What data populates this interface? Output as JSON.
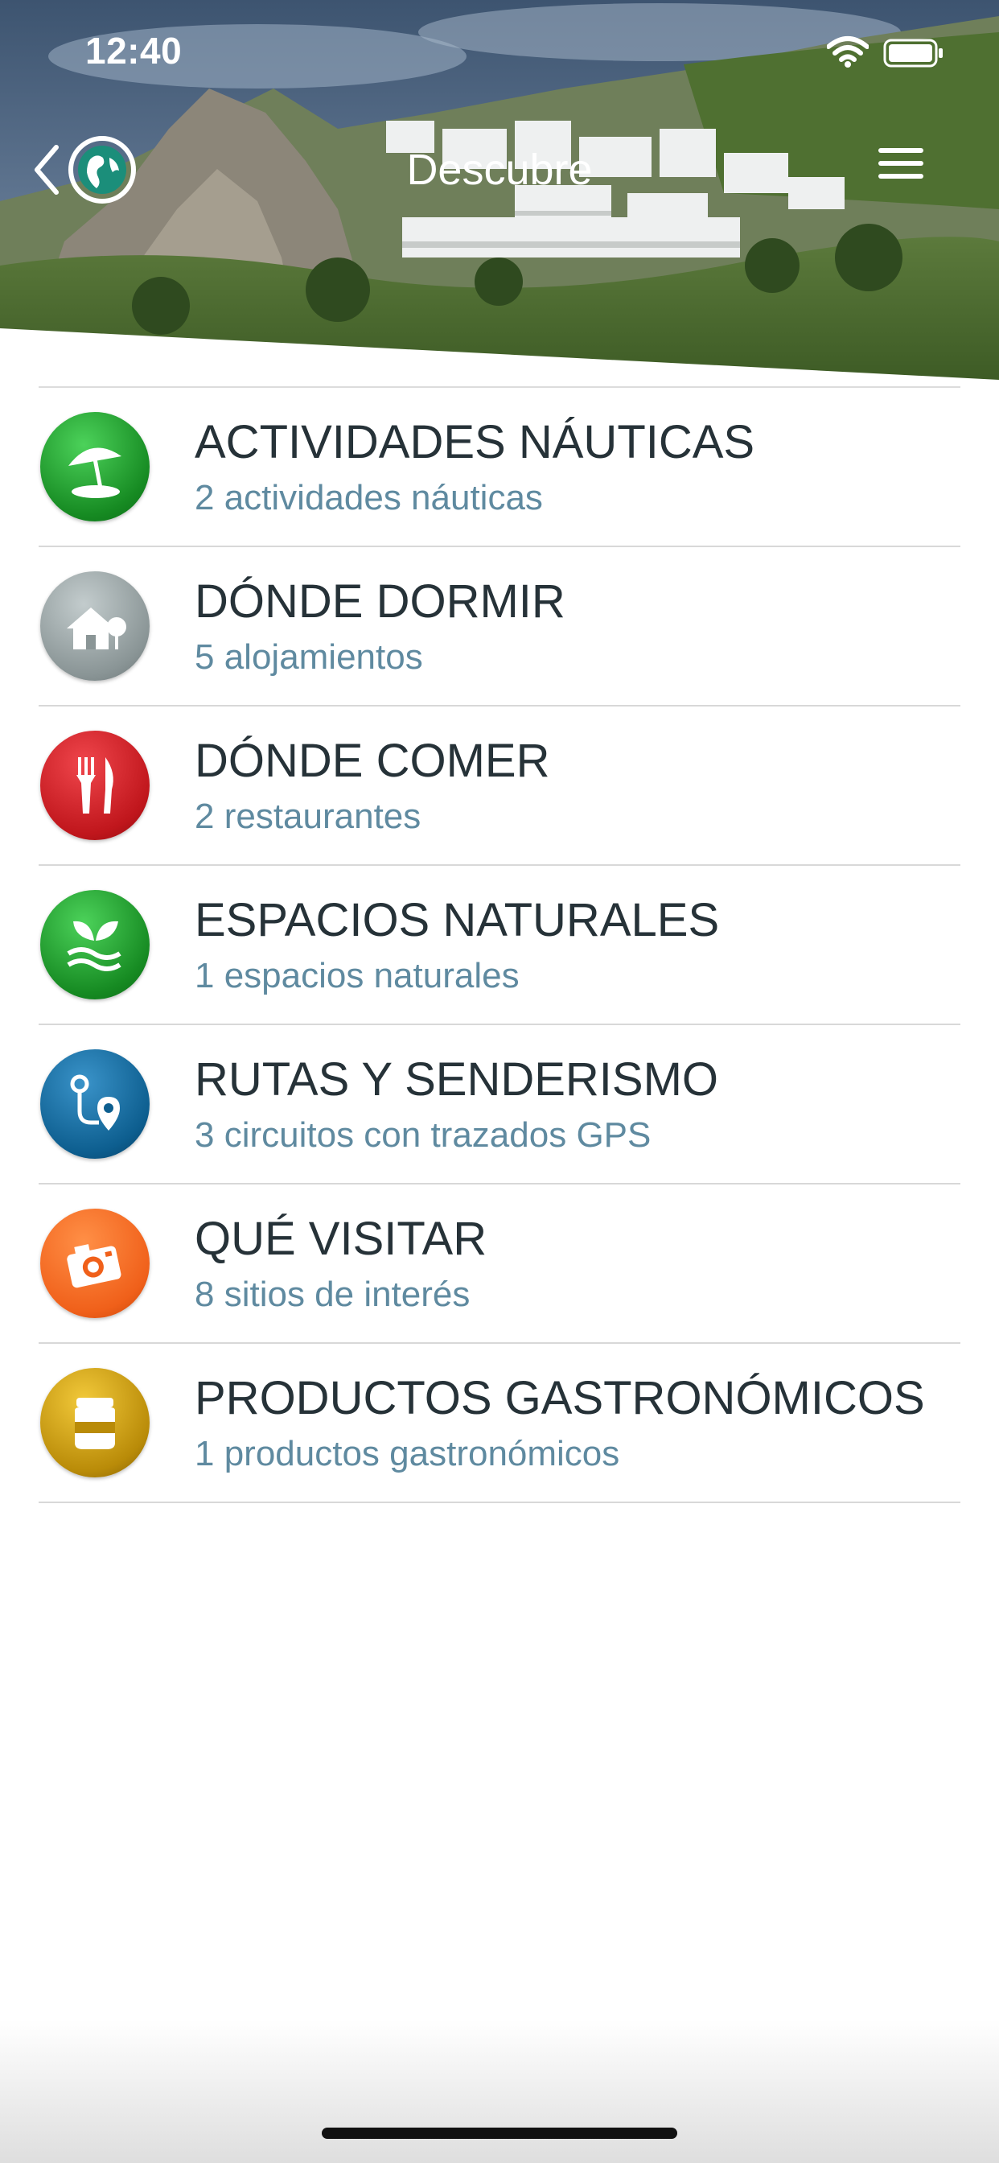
{
  "status_bar": {
    "time": "12:40"
  },
  "header": {
    "title": "Descubre"
  },
  "icons": {
    "back": "chevron-left-icon",
    "globe": "globe-icon",
    "menu": "hamburger-menu-icon",
    "wifi": "wifi-icon",
    "battery": "battery-icon"
  },
  "categories": [
    {
      "title": "ACTIVIDADES NÁUTICAS",
      "subtitle": "2 actividades náuticas",
      "icon": "beach-umbrella-icon",
      "color": "#1f9e2a"
    },
    {
      "title": "DÓNDE DORMIR",
      "subtitle": "5 alojamientos",
      "icon": "house-icon",
      "color": "#8a9596"
    },
    {
      "title": "DÓNDE COMER",
      "subtitle": "2 restaurantes",
      "icon": "fork-knife-icon",
      "color": "#c0161c"
    },
    {
      "title": "ESPACIOS NATURALES",
      "subtitle": "1 espacios naturales",
      "icon": "leaf-icon",
      "color": "#1f9e2a"
    },
    {
      "title": "RUTAS Y SENDERISMO",
      "subtitle": "3 circuitos con trazados GPS",
      "icon": "route-pin-icon",
      "color": "#0d5e8f"
    },
    {
      "title": "QUÉ VISITAR",
      "subtitle": "8 sitios de interés",
      "icon": "camera-icon",
      "color": "#f0601a"
    },
    {
      "title": "PRODUCTOS GASTRONÓMICOS",
      "subtitle": "1 productos gastronómicos",
      "icon": "jar-icon",
      "color": "#b98b08"
    }
  ]
}
